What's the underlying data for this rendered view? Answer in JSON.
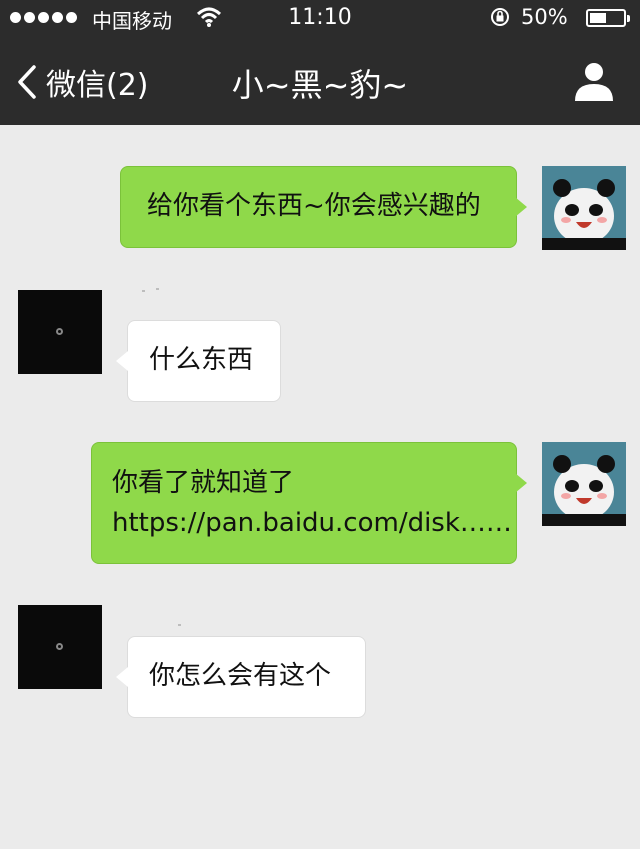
{
  "status_bar": {
    "carrier": "中国移动",
    "time": "11:10",
    "battery_percent_label": "50%",
    "battery_level": 0.5,
    "icons": [
      "signal-dots-icon",
      "wifi-icon",
      "rotation-lock-icon",
      "battery-icon"
    ]
  },
  "nav": {
    "back_label": "微信(2)",
    "title": "小~黑~豹~",
    "icons": [
      "chevron-left-icon",
      "profile-icon"
    ]
  },
  "messages": [
    {
      "from": "me",
      "lines": [
        "给你看个东西~你会感兴趣的"
      ]
    },
    {
      "from": "contact",
      "lines": [
        "什么东西"
      ]
    },
    {
      "from": "me",
      "lines": [
        "你看了就知道了",
        "https://pan.baidu.com/disk……"
      ]
    },
    {
      "from": "contact",
      "lines": [
        "你怎么会有这个"
      ]
    }
  ],
  "colors": {
    "nav_bg": "#2c2c2c",
    "chat_bg": "#ebebeb",
    "sent_bubble": "#8fd94a",
    "received_bubble": "#ffffff"
  }
}
